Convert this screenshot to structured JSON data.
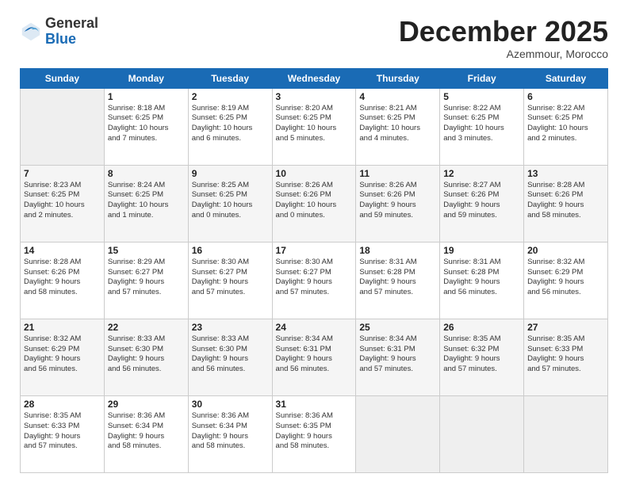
{
  "header": {
    "logo_line1": "General",
    "logo_line2": "Blue",
    "month": "December 2025",
    "location": "Azemmour, Morocco"
  },
  "days_of_week": [
    "Sunday",
    "Monday",
    "Tuesday",
    "Wednesday",
    "Thursday",
    "Friday",
    "Saturday"
  ],
  "weeks": [
    [
      {
        "day": "",
        "info": ""
      },
      {
        "day": "1",
        "info": "Sunrise: 8:18 AM\nSunset: 6:25 PM\nDaylight: 10 hours\nand 7 minutes."
      },
      {
        "day": "2",
        "info": "Sunrise: 8:19 AM\nSunset: 6:25 PM\nDaylight: 10 hours\nand 6 minutes."
      },
      {
        "day": "3",
        "info": "Sunrise: 8:20 AM\nSunset: 6:25 PM\nDaylight: 10 hours\nand 5 minutes."
      },
      {
        "day": "4",
        "info": "Sunrise: 8:21 AM\nSunset: 6:25 PM\nDaylight: 10 hours\nand 4 minutes."
      },
      {
        "day": "5",
        "info": "Sunrise: 8:22 AM\nSunset: 6:25 PM\nDaylight: 10 hours\nand 3 minutes."
      },
      {
        "day": "6",
        "info": "Sunrise: 8:22 AM\nSunset: 6:25 PM\nDaylight: 10 hours\nand 2 minutes."
      }
    ],
    [
      {
        "day": "7",
        "info": "Sunrise: 8:23 AM\nSunset: 6:25 PM\nDaylight: 10 hours\nand 2 minutes."
      },
      {
        "day": "8",
        "info": "Sunrise: 8:24 AM\nSunset: 6:25 PM\nDaylight: 10 hours\nand 1 minute."
      },
      {
        "day": "9",
        "info": "Sunrise: 8:25 AM\nSunset: 6:25 PM\nDaylight: 10 hours\nand 0 minutes."
      },
      {
        "day": "10",
        "info": "Sunrise: 8:26 AM\nSunset: 6:26 PM\nDaylight: 10 hours\nand 0 minutes."
      },
      {
        "day": "11",
        "info": "Sunrise: 8:26 AM\nSunset: 6:26 PM\nDaylight: 9 hours\nand 59 minutes."
      },
      {
        "day": "12",
        "info": "Sunrise: 8:27 AM\nSunset: 6:26 PM\nDaylight: 9 hours\nand 59 minutes."
      },
      {
        "day": "13",
        "info": "Sunrise: 8:28 AM\nSunset: 6:26 PM\nDaylight: 9 hours\nand 58 minutes."
      }
    ],
    [
      {
        "day": "14",
        "info": "Sunrise: 8:28 AM\nSunset: 6:26 PM\nDaylight: 9 hours\nand 58 minutes."
      },
      {
        "day": "15",
        "info": "Sunrise: 8:29 AM\nSunset: 6:27 PM\nDaylight: 9 hours\nand 57 minutes."
      },
      {
        "day": "16",
        "info": "Sunrise: 8:30 AM\nSunset: 6:27 PM\nDaylight: 9 hours\nand 57 minutes."
      },
      {
        "day": "17",
        "info": "Sunrise: 8:30 AM\nSunset: 6:27 PM\nDaylight: 9 hours\nand 57 minutes."
      },
      {
        "day": "18",
        "info": "Sunrise: 8:31 AM\nSunset: 6:28 PM\nDaylight: 9 hours\nand 57 minutes."
      },
      {
        "day": "19",
        "info": "Sunrise: 8:31 AM\nSunset: 6:28 PM\nDaylight: 9 hours\nand 56 minutes."
      },
      {
        "day": "20",
        "info": "Sunrise: 8:32 AM\nSunset: 6:29 PM\nDaylight: 9 hours\nand 56 minutes."
      }
    ],
    [
      {
        "day": "21",
        "info": "Sunrise: 8:32 AM\nSunset: 6:29 PM\nDaylight: 9 hours\nand 56 minutes."
      },
      {
        "day": "22",
        "info": "Sunrise: 8:33 AM\nSunset: 6:30 PM\nDaylight: 9 hours\nand 56 minutes."
      },
      {
        "day": "23",
        "info": "Sunrise: 8:33 AM\nSunset: 6:30 PM\nDaylight: 9 hours\nand 56 minutes."
      },
      {
        "day": "24",
        "info": "Sunrise: 8:34 AM\nSunset: 6:31 PM\nDaylight: 9 hours\nand 56 minutes."
      },
      {
        "day": "25",
        "info": "Sunrise: 8:34 AM\nSunset: 6:31 PM\nDaylight: 9 hours\nand 57 minutes."
      },
      {
        "day": "26",
        "info": "Sunrise: 8:35 AM\nSunset: 6:32 PM\nDaylight: 9 hours\nand 57 minutes."
      },
      {
        "day": "27",
        "info": "Sunrise: 8:35 AM\nSunset: 6:33 PM\nDaylight: 9 hours\nand 57 minutes."
      }
    ],
    [
      {
        "day": "28",
        "info": "Sunrise: 8:35 AM\nSunset: 6:33 PM\nDaylight: 9 hours\nand 57 minutes."
      },
      {
        "day": "29",
        "info": "Sunrise: 8:36 AM\nSunset: 6:34 PM\nDaylight: 9 hours\nand 58 minutes."
      },
      {
        "day": "30",
        "info": "Sunrise: 8:36 AM\nSunset: 6:34 PM\nDaylight: 9 hours\nand 58 minutes."
      },
      {
        "day": "31",
        "info": "Sunrise: 8:36 AM\nSunset: 6:35 PM\nDaylight: 9 hours\nand 58 minutes."
      },
      {
        "day": "",
        "info": ""
      },
      {
        "day": "",
        "info": ""
      },
      {
        "day": "",
        "info": ""
      }
    ]
  ]
}
